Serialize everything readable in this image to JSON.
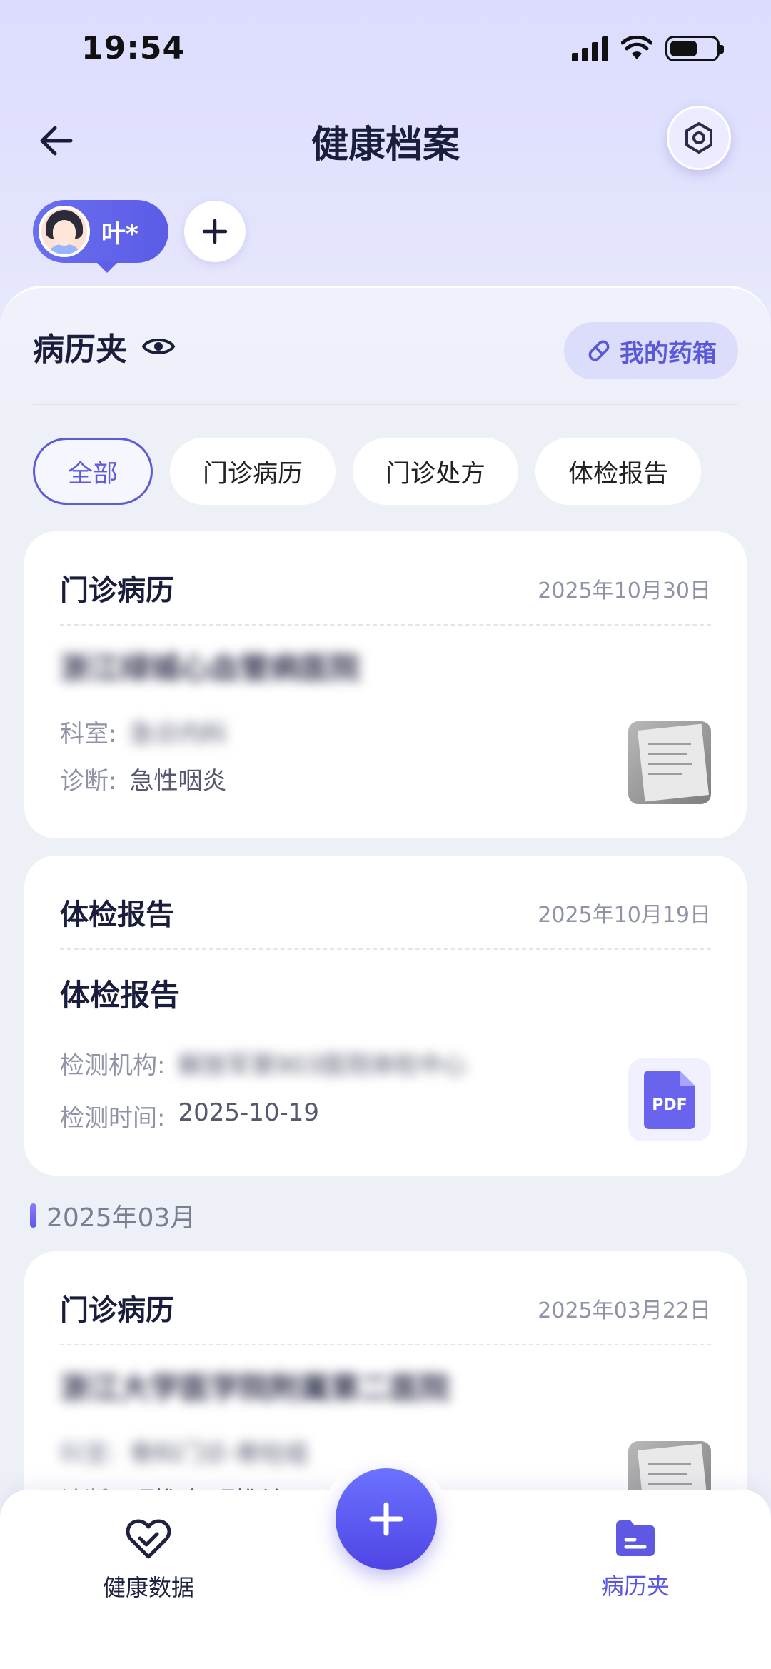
{
  "status_bar": {
    "time": "19:54"
  },
  "header": {
    "title": "健康档案",
    "back_icon": "back-arrow-icon",
    "settings_icon": "settings-icon"
  },
  "profile": {
    "name": "叶*",
    "add_icon": "plus-icon"
  },
  "folder": {
    "title": "病历夹",
    "visibility_icon": "eye-icon",
    "medicine_button": "我的药箱",
    "medicine_icon": "pill-icon"
  },
  "filters": {
    "tabs": [
      {
        "label": "全部",
        "active": true
      },
      {
        "label": "门诊病历",
        "active": false
      },
      {
        "label": "门诊处方",
        "active": false
      },
      {
        "label": "体检报告",
        "active": false
      }
    ]
  },
  "records": {
    "card1": {
      "type": "门诊病历",
      "date": "2025年10月30日",
      "hospital": "浙江绿城心血管病医院",
      "dept_label": "科室:",
      "dept_value": "急诊内科",
      "diag_label": "诊断:",
      "diag_value": "急性咽炎"
    },
    "card2": {
      "type": "体检报告",
      "date": "2025年10月19日",
      "title": "体检报告",
      "org_label": "检测机构:",
      "org_value": "解放军第903医院体检中心",
      "time_label": "检测时间:",
      "time_value": "2025-10-19",
      "file_badge": "PDF"
    },
    "month_group": "2025年03月",
    "card3": {
      "type": "门诊病历",
      "date": "2025年03月22日",
      "hospital": "浙江大学医学院附属第二医院",
      "dept_label": "科室:",
      "dept_value": "骨科门诊-脊柱组",
      "diag_label": "诊断:",
      "diag_value": "颈椎病;颈椎关"
    }
  },
  "bottom_nav": {
    "left_label": "健康数据",
    "right_label": "病历夹",
    "fab_icon": "plus-icon"
  },
  "colors": {
    "accent": "#5a57dc",
    "background": "#eef0f8",
    "header_bg": "#dcdcff"
  }
}
